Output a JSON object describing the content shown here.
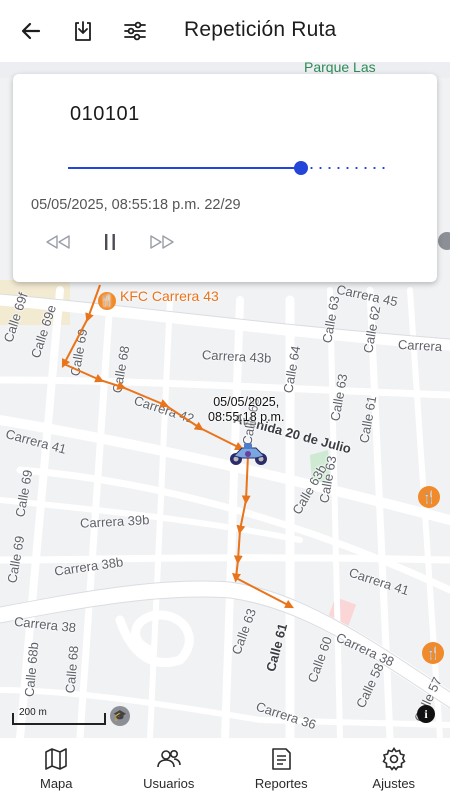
{
  "header": {
    "title": "Repetición Ruta",
    "back_icon": "arrow-left-icon",
    "download_icon": "download-icon",
    "filter_icon": "sliders-icon"
  },
  "player": {
    "vehicle_id": "010101",
    "timestamp": "05/05/2025, 08:55:18 p.m. 22/29",
    "progress": 0.7333,
    "current_point": 22,
    "total_points": 29,
    "accent_color": "#2446d8"
  },
  "map": {
    "park_label": "Parque Las",
    "poi_kfc": "KFC Carrera 43",
    "streets": {
      "carrera_45": "Carrera 45",
      "calle_69f": "Calle 69f",
      "calle_69e": "Calle 69e",
      "calle_69": "Calle 69",
      "calle_68": "Calle 68",
      "calle_63": "Calle 63",
      "calle_62": "Calle 62",
      "carrera_43b": "Carrera 43b",
      "carrera": "Carrera",
      "calle_64": "Calle 64",
      "carrera_41": "Carrera 41",
      "carrera_42": "Carrera 42",
      "avenida_20_julio": "Avenida 20 de Julio",
      "calle_61": "Calle 61",
      "calle_63b": "Calle 63b",
      "calle_65": "Calle 65",
      "carrera_39b": "Carrera 39b",
      "carrera_38b": "Carrera 38b",
      "calle_69_low": "Calle 69",
      "carrera_41_right": "Carrera 41",
      "carrera_38_left": "Carrera 38",
      "carrera_38_right": "Carrera 38",
      "calle_68b": "Calle 68b",
      "calle_68_low": "Calle 68",
      "calle_63_low": "Calle 63",
      "calle_61_low": "Calle 61",
      "calle_60": "Calle 60",
      "calle_58": "Calle 58",
      "calle_57": "Calle 57",
      "carrera_36": "Carrera 36"
    },
    "marker_label_date": "05/05/2025,",
    "marker_label_time": "08:55:18 p.m.",
    "route_color": "#e8741c",
    "scale_label": "200 m",
    "info_icon": "info-icon"
  },
  "bottom_nav": [
    {
      "label": "Mapa",
      "icon": "map-icon"
    },
    {
      "label": "Usuarios",
      "icon": "users-icon"
    },
    {
      "label": "Reportes",
      "icon": "report-icon"
    },
    {
      "label": "Ajustes",
      "icon": "gear-icon"
    }
  ]
}
